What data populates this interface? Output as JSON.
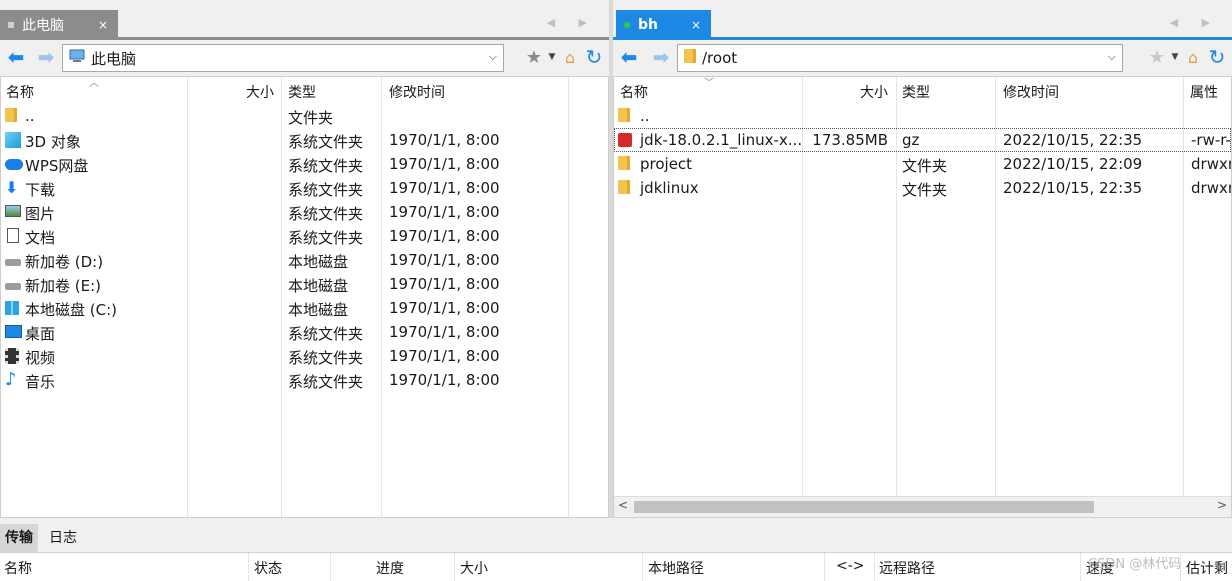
{
  "left_pane": {
    "tab": {
      "label": "此电脑",
      "close": "×"
    },
    "tab_arrows": "◀ ▶",
    "address": "此电脑",
    "columns": [
      "名称",
      "大小",
      "类型",
      "修改时间"
    ],
    "rows": [
      {
        "name": "..",
        "size": "",
        "type": "文件夹",
        "modified": "",
        "icon": "folder-icon"
      },
      {
        "name": "3D 对象",
        "size": "",
        "type": "系统文件夹",
        "modified": "1970/1/1, 8:00",
        "icon": "3d-objects-icon"
      },
      {
        "name": "WPS网盘",
        "size": "",
        "type": "系统文件夹",
        "modified": "1970/1/1, 8:00",
        "icon": "cloud-icon"
      },
      {
        "name": "下载",
        "size": "",
        "type": "系统文件夹",
        "modified": "1970/1/1, 8:00",
        "icon": "download-icon"
      },
      {
        "name": "图片",
        "size": "",
        "type": "系统文件夹",
        "modified": "1970/1/1, 8:00",
        "icon": "pictures-icon"
      },
      {
        "name": "文档",
        "size": "",
        "type": "系统文件夹",
        "modified": "1970/1/1, 8:00",
        "icon": "document-icon"
      },
      {
        "name": "新加卷 (D:)",
        "size": "",
        "type": "本地磁盘",
        "modified": "1970/1/1, 8:00",
        "icon": "drive-icon"
      },
      {
        "name": "新加卷 (E:)",
        "size": "",
        "type": "本地磁盘",
        "modified": "1970/1/1, 8:00",
        "icon": "drive-icon"
      },
      {
        "name": "本地磁盘 (C:)",
        "size": "",
        "type": "本地磁盘",
        "modified": "1970/1/1, 8:00",
        "icon": "windows-drive-icon"
      },
      {
        "name": "桌面",
        "size": "",
        "type": "系统文件夹",
        "modified": "1970/1/1, 8:00",
        "icon": "desktop-icon"
      },
      {
        "name": "视频",
        "size": "",
        "type": "系统文件夹",
        "modified": "1970/1/1, 8:00",
        "icon": "video-icon"
      },
      {
        "name": "音乐",
        "size": "",
        "type": "系统文件夹",
        "modified": "1970/1/1, 8:00",
        "icon": "music-icon"
      }
    ]
  },
  "right_pane": {
    "tab": {
      "label": "bh",
      "close": "×"
    },
    "tab_arrows": "◀ ▶",
    "address": "/root",
    "columns": [
      "名称",
      "大小",
      "类型",
      "修改时间",
      "属性"
    ],
    "rows": [
      {
        "name": "..",
        "size": "",
        "type": "",
        "modified": "",
        "attr": "",
        "icon": "folder-icon"
      },
      {
        "name": "jdk-18.0.2.1_linux-x...",
        "size": "173.85MB",
        "type": "gz",
        "modified": "2022/10/15, 22:35",
        "attr": "-rw-r--",
        "icon": "archive-icon",
        "selected": true
      },
      {
        "name": "project",
        "size": "",
        "type": "文件夹",
        "modified": "2022/10/15, 22:09",
        "attr": "drwxr",
        "icon": "folder-icon"
      },
      {
        "name": "jdklinux",
        "size": "",
        "type": "文件夹",
        "modified": "2022/10/15, 22:35",
        "attr": "drwxr",
        "icon": "folder-icon"
      }
    ],
    "scroll_left": "<",
    "scroll_right": ">"
  },
  "transfer": {
    "tabs": [
      "传输",
      "日志"
    ],
    "columns": [
      "名称",
      "状态",
      "进度",
      "大小",
      "本地路径",
      "<->",
      "远程路径",
      "速度",
      "估计剩"
    ]
  },
  "watermark": "CSDN @林代码"
}
